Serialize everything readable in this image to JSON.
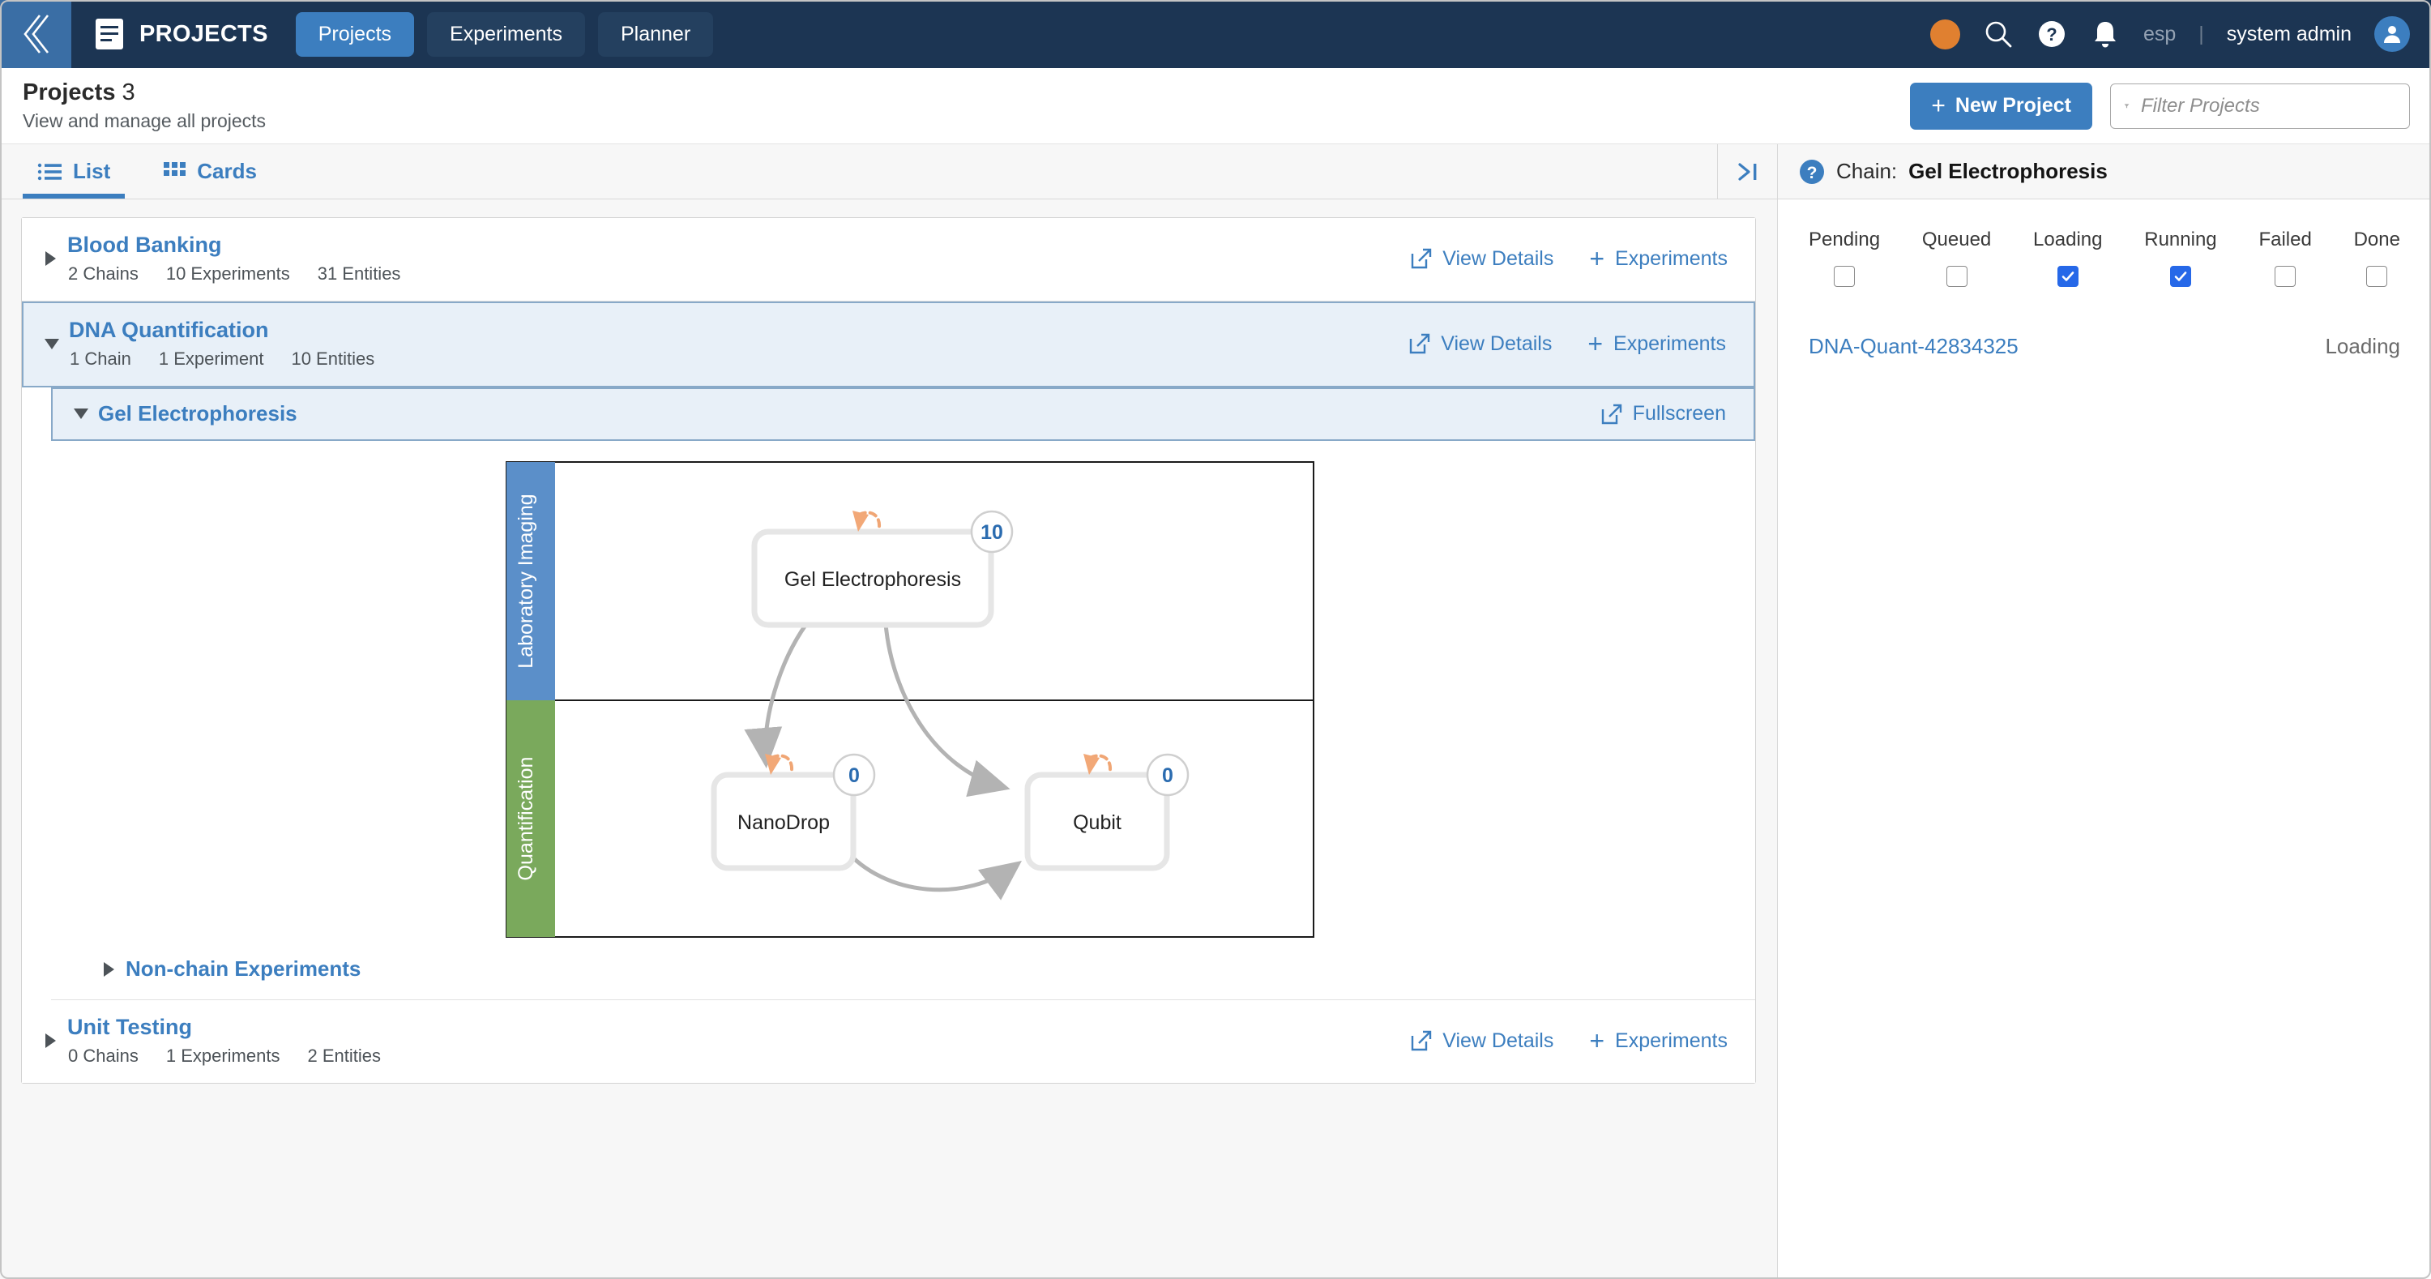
{
  "topbar": {
    "back_icon": "double-chevron-left-icon",
    "brand_icon": "document-icon",
    "brand": "PROJECTS",
    "tabs": [
      {
        "label": "Projects",
        "active": true
      },
      {
        "label": "Experiments",
        "active": false
      },
      {
        "label": "Planner",
        "active": false
      }
    ],
    "status_dot_color": "#e08030",
    "search_icon": "search-icon",
    "help_icon": "help-circle-icon",
    "notifications_icon": "bell-icon",
    "locale": "esp",
    "divider": "|",
    "user": "system admin",
    "avatar_icon": "user-avatar-icon"
  },
  "pagehead": {
    "title": "Projects",
    "count": "3",
    "subtitle": "View and manage all projects",
    "new_project_label": "New Project",
    "new_project_plus": "+",
    "filter_icon": "funnel-icon",
    "filter_placeholder": "Filter Projects",
    "filter_value": ""
  },
  "viewtabs": {
    "list_label": "List",
    "list_icon": "list-icon",
    "cards_label": "Cards",
    "cards_icon": "grid-icon",
    "collapse_icon": "collapse-panel-right-icon"
  },
  "projects": [
    {
      "name": "Blood Banking",
      "expanded": false,
      "selected": false,
      "stats": [
        "2 Chains",
        "10 Experiments",
        "31 Entities"
      ],
      "view_details": "View Details",
      "experiments_action": "Experiments"
    },
    {
      "name": "DNA Quantification",
      "expanded": true,
      "selected": true,
      "stats": [
        "1 Chain",
        "1 Experiment",
        "10 Entities"
      ],
      "view_details": "View Details",
      "experiments_action": "Experiments"
    },
    {
      "name": "Unit Testing",
      "expanded": false,
      "selected": false,
      "stats": [
        "0 Chains",
        "1 Experiments",
        "2 Entities"
      ],
      "view_details": "View Details",
      "experiments_action": "Experiments"
    }
  ],
  "chain": {
    "name": "Gel Electrophoresis",
    "expanded": true,
    "fullscreen_label": "Fullscreen"
  },
  "nonchain": {
    "label": "Non-chain Experiments",
    "expanded": false
  },
  "diagram": {
    "lanes": [
      {
        "label": "Laboratory Imaging",
        "color": "#5b8fc9"
      },
      {
        "label": "Quantification",
        "color": "#7aa95c"
      }
    ],
    "nodes": [
      {
        "id": "gel",
        "label": "Gel Electrophoresis",
        "badge": "10",
        "lane": 0
      },
      {
        "id": "nano",
        "label": "NanoDrop",
        "badge": "0",
        "lane": 1
      },
      {
        "id": "qubit",
        "label": "Qubit",
        "badge": "0",
        "lane": 1
      }
    ],
    "edges": [
      {
        "from": "gel",
        "to": "nano"
      },
      {
        "from": "gel",
        "to": "qubit"
      },
      {
        "from": "nano",
        "to": "qubit"
      }
    ],
    "loop_icon_color": "#f0a675",
    "edge_color": "#b0b0b0",
    "badge_text_color": "#2b6cb0"
  },
  "rightpanel": {
    "help_icon": "help-circle-icon",
    "chain_label": "Chain:",
    "chain_value": "Gel Electrophoresis",
    "statuses": [
      {
        "label": "Pending",
        "checked": false
      },
      {
        "label": "Queued",
        "checked": false
      },
      {
        "label": "Loading",
        "checked": true
      },
      {
        "label": "Running",
        "checked": true
      },
      {
        "label": "Failed",
        "checked": false
      },
      {
        "label": "Done",
        "checked": false
      }
    ],
    "experiments": [
      {
        "id": "DNA-Quant-42834325",
        "status": "Loading"
      }
    ],
    "checkbox_accent": "#2668e8"
  }
}
